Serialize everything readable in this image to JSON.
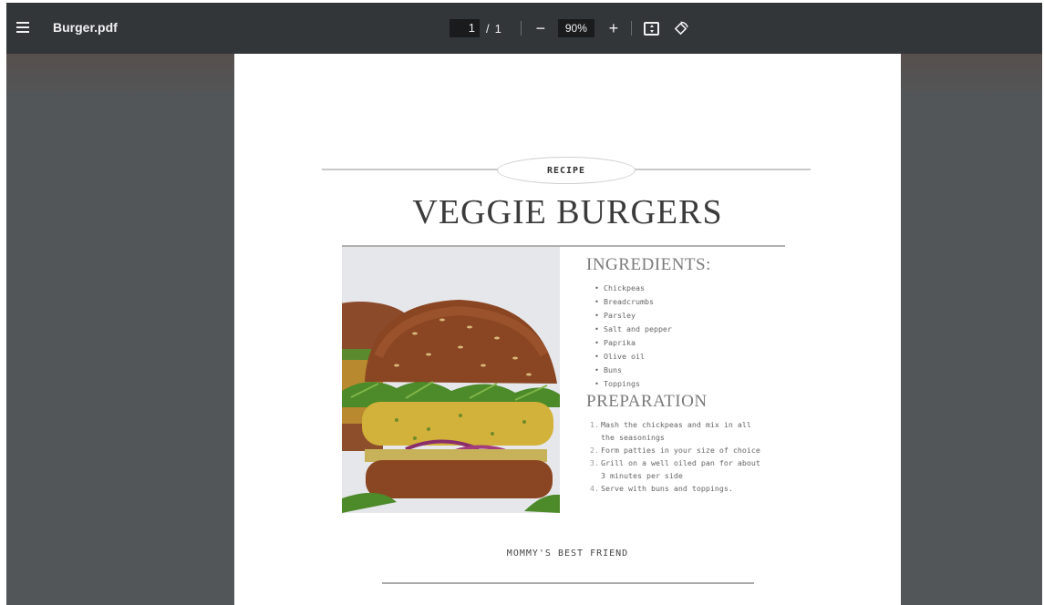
{
  "toolbar": {
    "title": "Burger.pdf",
    "page_current": "1",
    "page_separator": "/",
    "page_total": "1",
    "zoom_out_label": "−",
    "zoom_level": "90%",
    "zoom_in_label": "+"
  },
  "icons": {
    "menu": "hamburger-menu-icon",
    "fit": "fit-to-page-icon",
    "rotate": "rotate-counterclockwise-icon"
  },
  "colors": {
    "toolbar": "#323639",
    "viewer_bg": "#525659",
    "page": "#ffffff"
  },
  "document": {
    "badge": "RECIPE",
    "title": "VEGGIE BURGERS",
    "ingredients_heading": "INGREDIENTS:",
    "ingredients": [
      "Chickpeas",
      "Breadcrumbs",
      "Parsley",
      "Salt and pepper",
      "Paprika",
      "Olive oil",
      "Buns",
      "Toppings"
    ],
    "preparation_heading": "PREPARATION",
    "steps": [
      {
        "num": "1.",
        "text": "Mash the chickpeas and mix in all the seasonings"
      },
      {
        "num": "2.",
        "text": "Form patties in your size of choice"
      },
      {
        "num": "3.",
        "text": "Grill on a well oiled pan for about 3 minutes per side"
      },
      {
        "num": "4.",
        "text": "Serve with buns and toppings."
      }
    ],
    "footer": "MOMMY'S BEST FRIEND"
  }
}
